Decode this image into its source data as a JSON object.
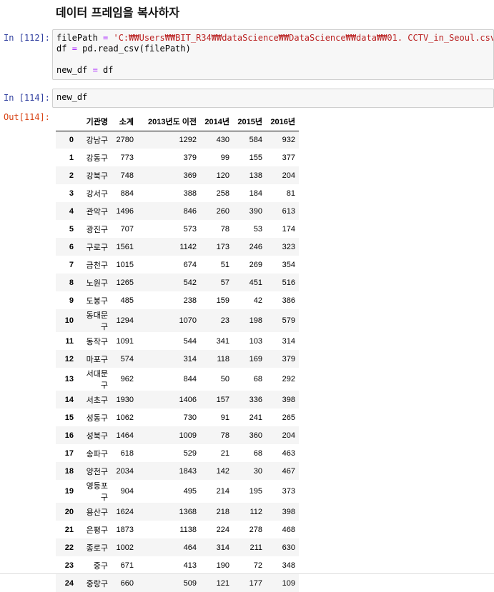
{
  "heading": "데이터 프레임을 복사하자",
  "cells": [
    {
      "prompt": "In [112]:",
      "lines": [
        [
          "filePath ",
          "= ",
          "'C:₩₩Users₩₩BIT_R34₩₩dataScience₩₩DataScience₩₩data₩₩01. CCTV_in_Seoul.csv'"
        ],
        [
          "df ",
          "= ",
          "pd.read_csv(filePath)"
        ],
        [
          "",
          "",
          ""
        ],
        [
          "new_df ",
          "= ",
          "df"
        ]
      ]
    },
    {
      "prompt": "In [114]:",
      "code": "new_df"
    }
  ],
  "output": {
    "prompt": "Out[114]:",
    "columns": [
      "",
      "기관명",
      "소계",
      "2013년도 이전",
      "2014년",
      "2015년",
      "2016년"
    ],
    "rows": [
      [
        "0",
        "강남구",
        "2780",
        "1292",
        "430",
        "584",
        "932"
      ],
      [
        "1",
        "강동구",
        "773",
        "379",
        "99",
        "155",
        "377"
      ],
      [
        "2",
        "강북구",
        "748",
        "369",
        "120",
        "138",
        "204"
      ],
      [
        "3",
        "강서구",
        "884",
        "388",
        "258",
        "184",
        "81"
      ],
      [
        "4",
        "관악구",
        "1496",
        "846",
        "260",
        "390",
        "613"
      ],
      [
        "5",
        "광진구",
        "707",
        "573",
        "78",
        "53",
        "174"
      ],
      [
        "6",
        "구로구",
        "1561",
        "1142",
        "173",
        "246",
        "323"
      ],
      [
        "7",
        "금천구",
        "1015",
        "674",
        "51",
        "269",
        "354"
      ],
      [
        "8",
        "노원구",
        "1265",
        "542",
        "57",
        "451",
        "516"
      ],
      [
        "9",
        "도봉구",
        "485",
        "238",
        "159",
        "42",
        "386"
      ],
      [
        "10",
        "동대문구",
        "1294",
        "1070",
        "23",
        "198",
        "579"
      ],
      [
        "11",
        "동작구",
        "1091",
        "544",
        "341",
        "103",
        "314"
      ],
      [
        "12",
        "마포구",
        "574",
        "314",
        "118",
        "169",
        "379"
      ],
      [
        "13",
        "서대문구",
        "962",
        "844",
        "50",
        "68",
        "292"
      ],
      [
        "14",
        "서초구",
        "1930",
        "1406",
        "157",
        "336",
        "398"
      ],
      [
        "15",
        "성동구",
        "1062",
        "730",
        "91",
        "241",
        "265"
      ],
      [
        "16",
        "성북구",
        "1464",
        "1009",
        "78",
        "360",
        "204"
      ],
      [
        "17",
        "송파구",
        "618",
        "529",
        "21",
        "68",
        "463"
      ],
      [
        "18",
        "양천구",
        "2034",
        "1843",
        "142",
        "30",
        "467"
      ],
      [
        "19",
        "영등포구",
        "904",
        "495",
        "214",
        "195",
        "373"
      ],
      [
        "20",
        "용산구",
        "1624",
        "1368",
        "218",
        "112",
        "398"
      ],
      [
        "21",
        "은평구",
        "1873",
        "1138",
        "224",
        "278",
        "468"
      ],
      [
        "22",
        "종로구",
        "1002",
        "464",
        "314",
        "211",
        "630"
      ],
      [
        "23",
        "중구",
        "671",
        "413",
        "190",
        "72",
        "348"
      ],
      [
        "24",
        "중랑구",
        "660",
        "509",
        "121",
        "177",
        "109"
      ]
    ]
  }
}
